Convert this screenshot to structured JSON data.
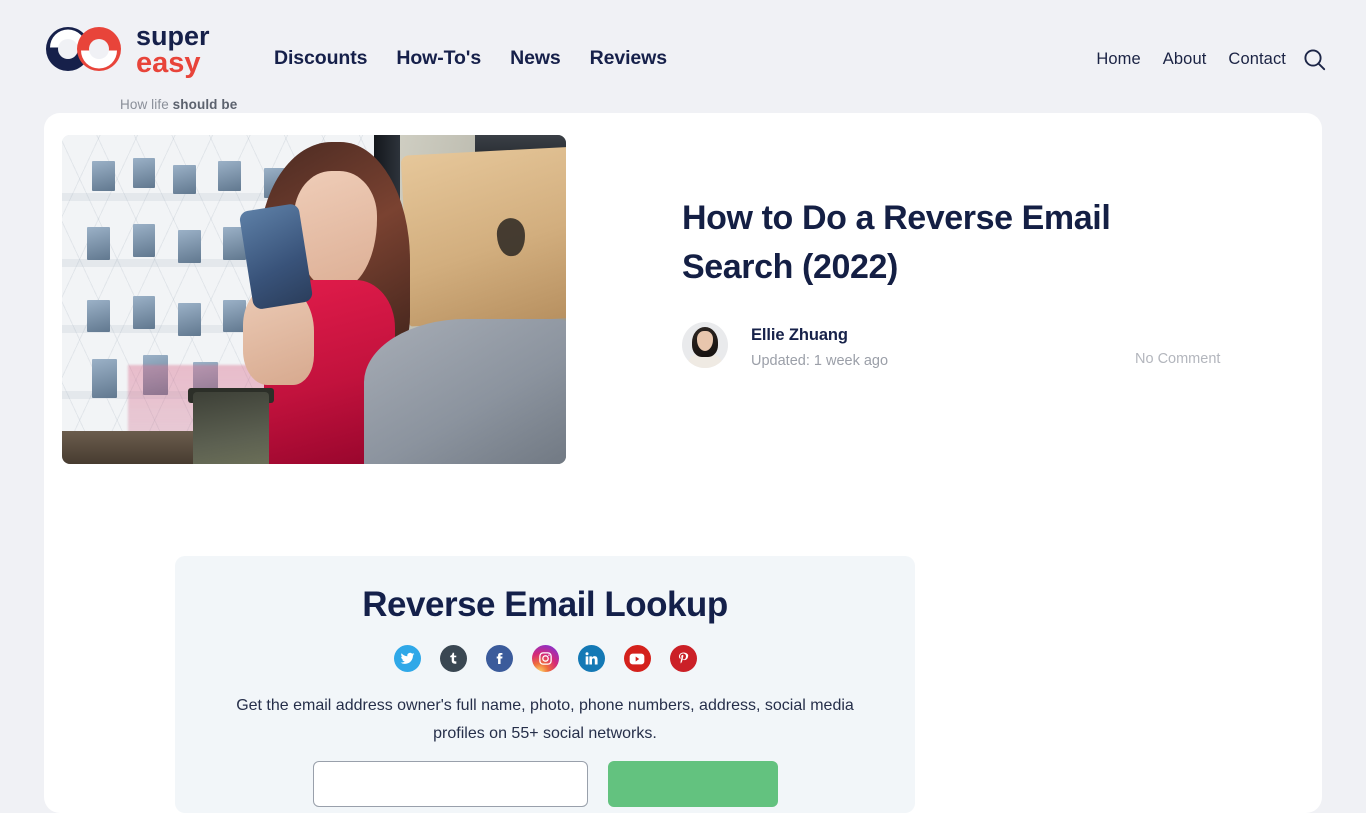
{
  "brand": {
    "name_line1": "super",
    "name_line2": "easy",
    "tagline_plain": "How life ",
    "tagline_bold": "should be",
    "navy": "#16204a",
    "red": "#e8443a"
  },
  "header": {
    "main_nav": [
      {
        "label": "Discounts"
      },
      {
        "label": "How-To's"
      },
      {
        "label": "News"
      },
      {
        "label": "Reviews"
      }
    ],
    "right_nav": [
      {
        "label": "Home"
      },
      {
        "label": "About"
      },
      {
        "label": "Contact"
      }
    ],
    "search_icon": "search-icon"
  },
  "article": {
    "title": "How to Do a Reverse Email Search (2022)",
    "author": "Ellie Zhuang",
    "updated": "Updated: 1 week ago",
    "comments": "No Comment",
    "hero_alt": "woman in red top looking at smartphone beside a laptop"
  },
  "lookup": {
    "title": "Reverse Email Lookup",
    "description": "Get the email address owner's full name, photo, phone numbers, address, social media profiles on 55+ social networks.",
    "socials": [
      {
        "name": "twitter",
        "glyph": "ᴠ",
        "class": "s-twitter"
      },
      {
        "name": "tumblr",
        "glyph": "t",
        "class": "s-tumblr"
      },
      {
        "name": "facebook",
        "glyph": "f",
        "class": "s-facebook"
      },
      {
        "name": "instagram",
        "glyph": "□",
        "class": "s-instagram"
      },
      {
        "name": "linkedin",
        "glyph": "in",
        "class": "s-linkedin"
      },
      {
        "name": "youtube",
        "glyph": "▶",
        "class": "s-youtube"
      },
      {
        "name": "pinterest",
        "glyph": "P",
        "class": "s-pinterest"
      }
    ],
    "email_placeholder": "",
    "email_value": "",
    "submit_label": ""
  },
  "colors": {
    "page_background": "#f0f1f5",
    "card_background": "#ffffff",
    "widget_background": "#f2f6f9",
    "title_navy": "#141f44",
    "muted_gray": "#9b9fa8",
    "green_button": "#63c27f"
  }
}
